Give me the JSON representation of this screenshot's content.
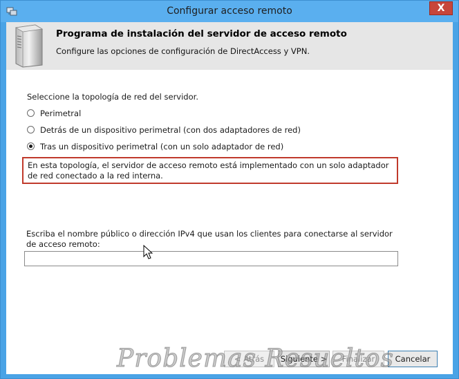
{
  "window": {
    "title": "Configurar acceso remoto",
    "close_label": "X",
    "accent": "#5aafef"
  },
  "header": {
    "title": "Programa de instalación del servidor de acceso remoto",
    "subtitle": "Configure las opciones de configuración de DirectAccess y VPN.",
    "icon": "server-icon"
  },
  "topology": {
    "prompt": "Seleccione la topología de red del servidor.",
    "options": [
      {
        "label": "Perimetral",
        "checked": false
      },
      {
        "label": "Detrás de un dispositivo perimetral (con dos adaptadores de red)",
        "checked": false
      },
      {
        "label": "Tras un dispositivo perimetral (con un solo adaptador de red)",
        "checked": true
      }
    ],
    "description": "En esta topología, el servidor de acceso remoto está implementado con un solo adaptador de red conectado a la red interna.",
    "highlight_color": "#c0392b"
  },
  "address": {
    "prompt": "Escriba el nombre público o dirección IPv4 que usan los clientes para conectarse al servidor de acceso remoto:",
    "value": ""
  },
  "buttons": {
    "back": "< Atrás",
    "next": "Siguiente >",
    "finish": "Finalizar",
    "cancel": "Cancelar"
  },
  "watermark": "Problemas Resueltos"
}
